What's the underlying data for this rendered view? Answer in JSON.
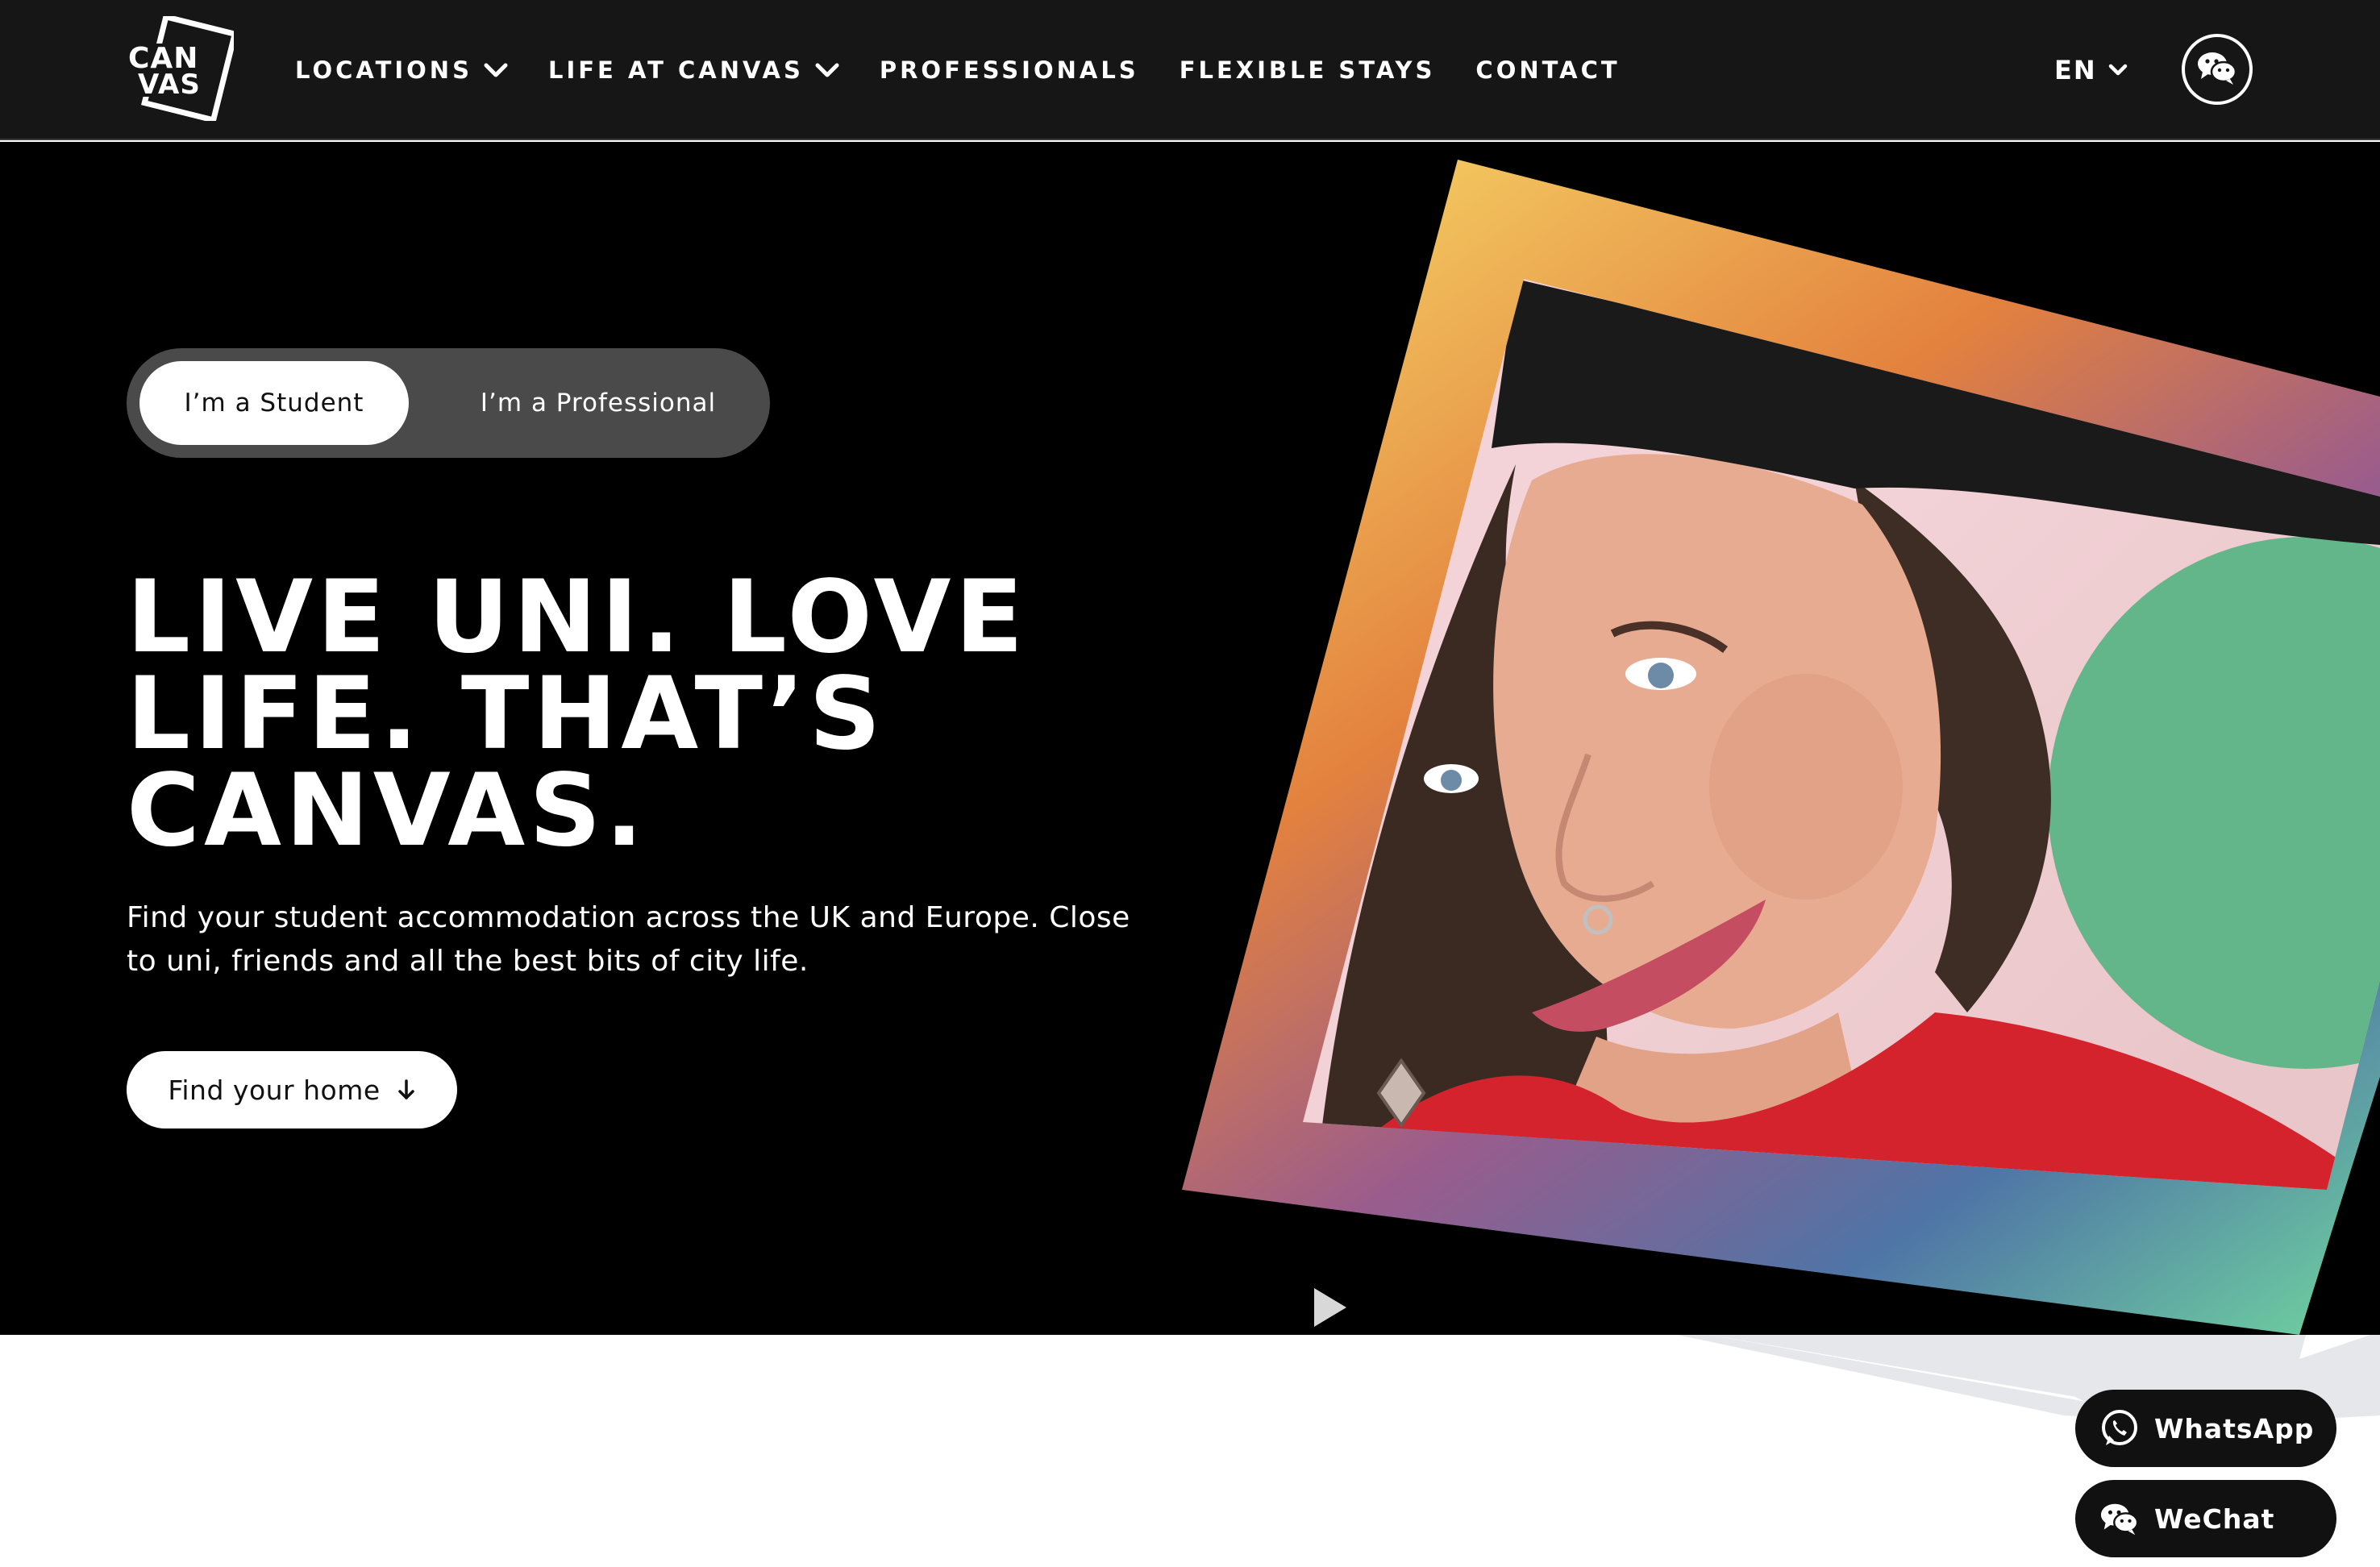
{
  "header": {
    "logo_text": [
      "CAN",
      "VAS"
    ],
    "nav": [
      {
        "label": "LOCATIONS",
        "has_dropdown": true
      },
      {
        "label": "LIFE AT CANVAS",
        "has_dropdown": true
      },
      {
        "label": "PROFESSIONALS",
        "has_dropdown": false
      },
      {
        "label": "FLEXIBLE STAYS",
        "has_dropdown": false
      },
      {
        "label": "CONTACT",
        "has_dropdown": false
      }
    ],
    "language": "EN",
    "wechat_icon": "wechat-icon"
  },
  "hero": {
    "toggle": {
      "student_label": "I’m a Student",
      "professional_label": "I’m a Professional",
      "selected": "student"
    },
    "headline_lines": [
      "LIVE UNI. LOVE",
      "LIFE. THAT’S",
      "CANVAS."
    ],
    "subtext_lines": [
      "Find your student accommodation across the UK and Europe. Close",
      "to uni, friends and all the best bits of city life."
    ],
    "cta_label": "Find your home",
    "cta_icon": "arrow-down-icon",
    "media": {
      "photo": "smiling-person-portrait",
      "frame": "rainbow-gradient-tilted-frame",
      "play_icon": "play-icon"
    }
  },
  "chat": {
    "whatsapp_label": "WhatsApp",
    "wechat_label": "WeChat"
  },
  "colors": {
    "header_bg": "#161616",
    "hero_bg": "#000000",
    "toggle_bg": "#4a4a4a",
    "text_light": "#ffffff",
    "gradient": [
      "#f2c25c",
      "#e0783c",
      "#8a5c9a",
      "#4a7fa8",
      "#6cc8a0"
    ]
  }
}
